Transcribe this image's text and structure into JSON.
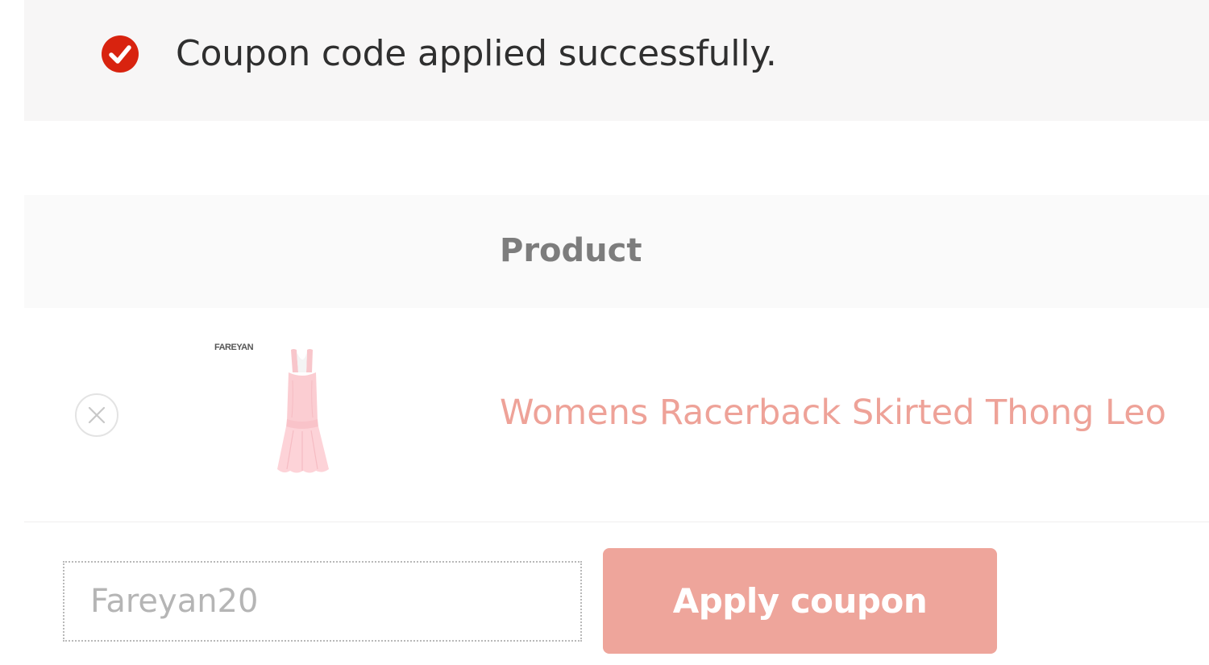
{
  "notice": {
    "icon": "check-circle-icon",
    "message": "Coupon code applied successfully.",
    "icon_color": "#d8230f"
  },
  "cart": {
    "columns": {
      "product": "Product"
    },
    "items": [
      {
        "remove_icon": "close-icon",
        "thumbnail_brand": "FAREYAN",
        "thumbnail_icon": "pink-dress-image",
        "name": "Womens Racerback Skirted Thong Leo"
      }
    ]
  },
  "coupon": {
    "input_value": "Fareyan20",
    "button_label": "Apply coupon",
    "accent_color": "#eea59b"
  }
}
